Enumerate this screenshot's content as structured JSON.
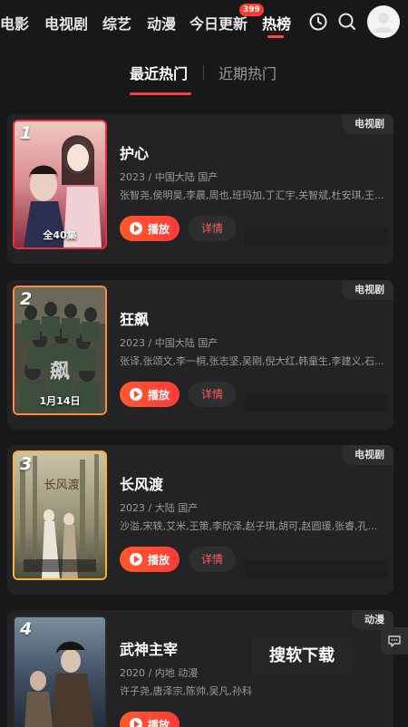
{
  "nav": {
    "items": [
      "电影",
      "电视剧",
      "综艺",
      "动漫",
      "今日更新",
      "热榜"
    ],
    "active_index": 5,
    "badge": "399",
    "icons": [
      "history-icon",
      "search-icon",
      "avatar"
    ]
  },
  "subtabs": {
    "active": "最近热门",
    "inactive": "近期热门"
  },
  "buttons": {
    "play": "播放",
    "detail": "详情"
  },
  "colors": {
    "accent": "#ff3b3b",
    "rank1": "#e8333a",
    "rank2": "#ff8c3a",
    "rank3": "#ffb02e"
  },
  "items": [
    {
      "rank": "1",
      "tag": "电视剧",
      "title": "护心",
      "meta": "2023 / 中国大陆 国产",
      "cast": "张智尧,侯明昊,李晨,周也,班玛加,丁汇宇,关智斌,杜安琪,王...",
      "poster_caption": "全40集"
    },
    {
      "rank": "2",
      "tag": "电视剧",
      "title": "狂飙",
      "meta": "2023 / 中国大陆 国产",
      "cast": "张译,张颂文,李一桐,张志坚,吴刚,倪大红,韩童生,李建义,石...",
      "poster_caption": "1月14日"
    },
    {
      "rank": "3",
      "tag": "电视剧",
      "title": "长风渡",
      "meta": "2023 / 大陆 国产",
      "cast": "沙溢,宋轶,艾米,王策,李欣泽,赵子琪,胡可,赵圆瑗,张睿,孔...",
      "poster_caption": ""
    },
    {
      "rank": "4",
      "tag": "动漫",
      "title": "武神主宰",
      "meta": "2020 / 内地 动漫",
      "cast": "许子尧,唐泽宗,陈帅,吴凡,孙科",
      "poster_caption": ""
    }
  ],
  "watermark": "搜软下载"
}
